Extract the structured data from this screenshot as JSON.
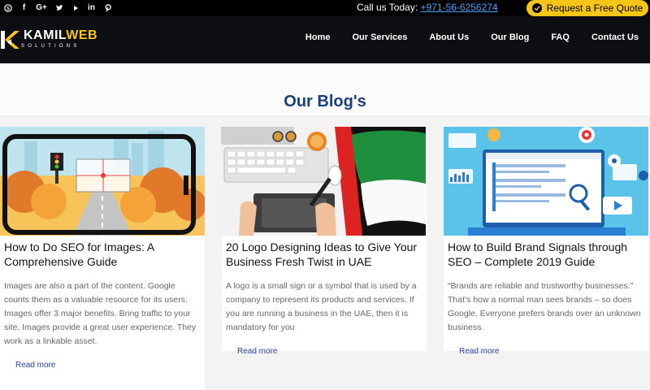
{
  "topbar": {
    "call_label": "Call us Today:",
    "phone": "+971-56-6256274",
    "quote_button": "Request a Free Quote",
    "socials": [
      "skype-icon",
      "facebook-icon",
      "google-plus-icon",
      "twitter-icon",
      "youtube-icon",
      "linkedin-icon",
      "pinterest-icon"
    ]
  },
  "brand": {
    "name_main": "KAMIL",
    "name_accent": "WEB",
    "name_sub": "SOLUTIONS",
    "accent_color": "#f5c518"
  },
  "nav": {
    "items": [
      "Home",
      "Our Services",
      "About Us",
      "Our Blog",
      "FAQ",
      "Contact Us"
    ]
  },
  "blog": {
    "title": "Our Blog's",
    "posts": [
      {
        "title": "How to Do SEO for Images: A Comprehensive Guide",
        "excerpt": "Images are also a part of the content. Google counts them as a valuable resource for its users. Images offer 3 major benefits. Bring traffic to your site. Images provide a great user experience.   They work as a linkable asset.",
        "read_more": "Read more"
      },
      {
        "title": "20 Logo Designing Ideas to Give Your Business Fresh Twist in UAE",
        "excerpt": "A logo is a small sign or a symbol that is used by a company to represent its products and services. If you are running a business in the UAE, then it is mandatory for you",
        "read_more": "Read more"
      },
      {
        "title": "How to Build Brand Signals through SEO – Complete 2019 Guide",
        "excerpt": "“Brands are reliable and trustworthy businesses.” That’s how a normal man sees brands – so does Google. Everyone prefers brands over an unknown business.",
        "read_more": "Read more"
      }
    ]
  }
}
